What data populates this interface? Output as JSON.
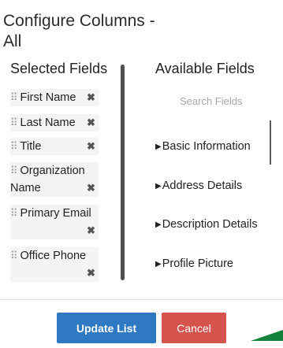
{
  "dialog": {
    "title": "Configure Columns - All"
  },
  "selected": {
    "heading": "Selected Fields",
    "fields": [
      {
        "label": "First Name"
      },
      {
        "label": "Last Name"
      },
      {
        "label": "Title"
      },
      {
        "label": "Organization Name"
      },
      {
        "label": "Primary Email"
      },
      {
        "label": "Office Phone"
      }
    ]
  },
  "available": {
    "heading": "Available Fields",
    "search_placeholder": "Search Fields",
    "groups": [
      {
        "label": "Basic Information"
      },
      {
        "label": "Address Details"
      },
      {
        "label": "Description Details"
      },
      {
        "label": "Profile Picture"
      }
    ]
  },
  "footer": {
    "update_label": "Update List",
    "cancel_label": "Cancel"
  },
  "icons": {
    "grip": "drag-handle-icon",
    "remove": "remove-x-icon",
    "expand": "triangle-right-icon"
  },
  "colors": {
    "primary_button": "#2f78c2",
    "cancel_button": "#d5534d",
    "field_background": "#f4f4f4"
  }
}
